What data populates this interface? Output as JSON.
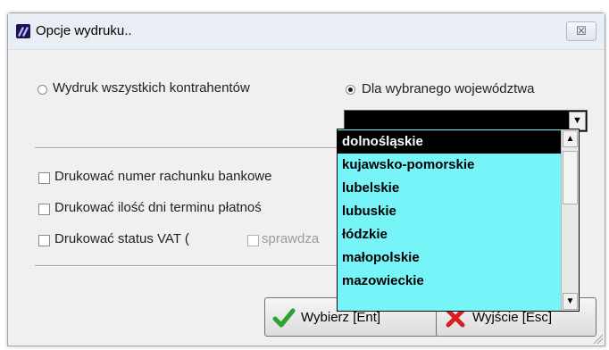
{
  "window": {
    "title": "Opcje wydruku..",
    "close_symbol": "☒"
  },
  "options": {
    "all_label": "Wydruk wszystkich kontrahentów",
    "voivodeship_label": "Dla wybranego województwa"
  },
  "combo": {
    "value": ""
  },
  "dropdown": {
    "items": [
      "dolnośląskie",
      "kujawsko-pomorskie",
      "lubelskie",
      "lubuskie",
      "łódzkie",
      "małopolskie",
      "mazowieckie"
    ]
  },
  "checkboxes": {
    "bank_label": "Drukować numer rachunku bankowe",
    "days_label": "Drukować ilość dni terminu płatnoś",
    "vat_label": "Drukować status VAT  (",
    "verify_label": "sprawdza"
  },
  "buttons": {
    "select_label": "Wybierz  [Ent]",
    "exit_label": "Wyjście  [Esc]"
  },
  "colors": {
    "dropdown_bg": "#77f4f8",
    "selected_bg": "#000000",
    "check_green": "#2ea12e",
    "x_red": "#d81e1e"
  }
}
